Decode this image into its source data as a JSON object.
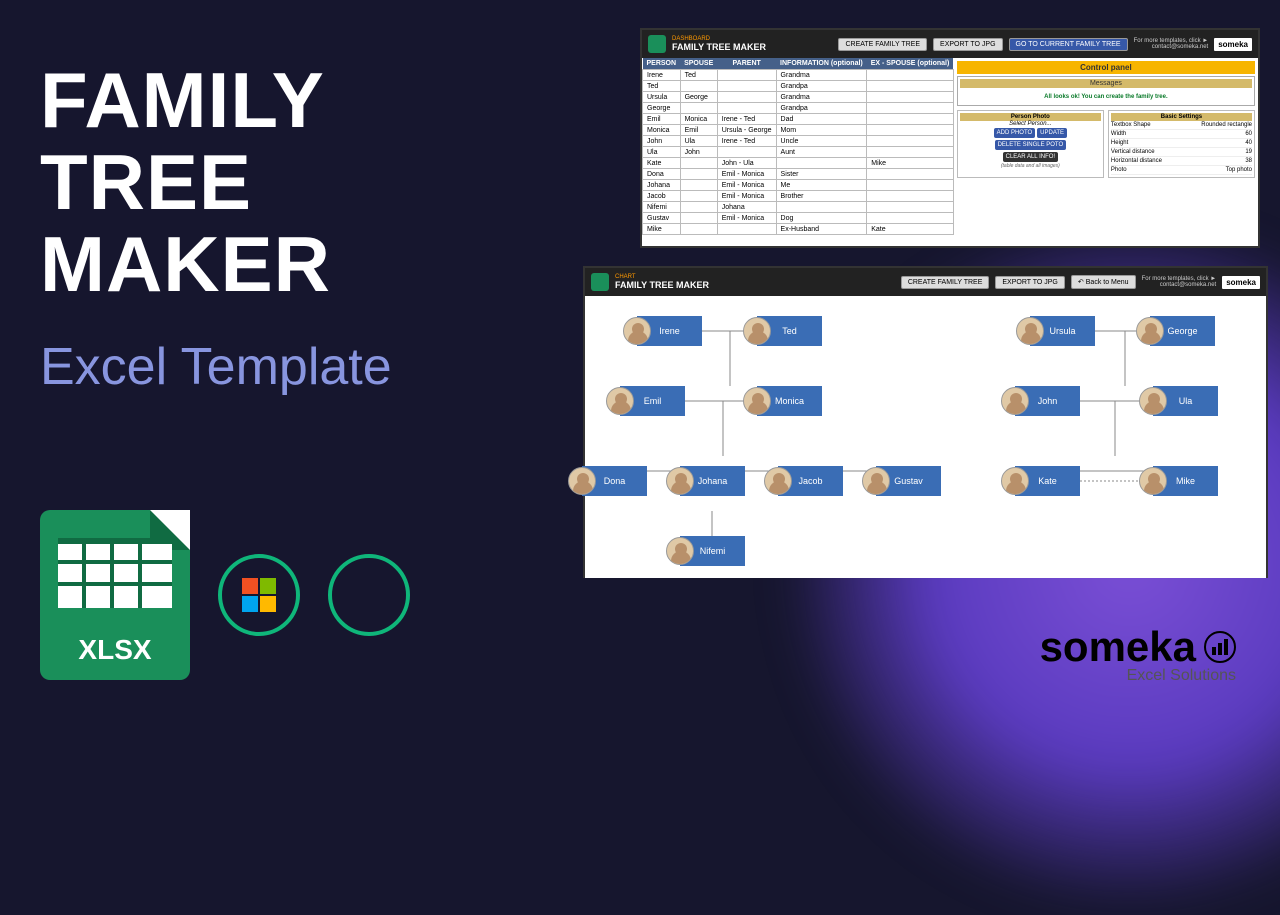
{
  "title_l1": "FAMILY",
  "title_l2": "TREE",
  "title_l3": "MAKER",
  "subtitle": "Excel Template",
  "xlsx_label": "XLSX",
  "brand": {
    "name": "someka",
    "sub": "Excel Solutions"
  },
  "dashboard": {
    "tab": "DASHBOARD",
    "name": "FAMILY TREE MAKER",
    "btn_create": "CREATE FAMILY TREE",
    "btn_export": "EXPORT TO JPG",
    "btn_goto": "GO TO  CURRENT FAMILY TREE",
    "more": "For more templates, click ►",
    "contact": "contact@someka.net",
    "cols": [
      "PERSON",
      "SPOUSE",
      "PARENT",
      "INFORMATION (optional)",
      "EX - SPOUSE (optional)"
    ],
    "rows": [
      [
        "Irene",
        "Ted",
        "",
        "Grandma",
        ""
      ],
      [
        "Ted",
        "",
        "",
        "Grandpa",
        ""
      ],
      [
        "Ursula",
        "George",
        "",
        "Grandma",
        ""
      ],
      [
        "George",
        "",
        "",
        "Grandpa",
        ""
      ],
      [
        "Emil",
        "Monica",
        "Irene - Ted",
        "Dad",
        ""
      ],
      [
        "Monica",
        "Emil",
        "Ursula - George",
        "Mom",
        ""
      ],
      [
        "John",
        "Ula",
        "Irene - Ted",
        "Uncle",
        ""
      ],
      [
        "Ula",
        "John",
        "",
        "Aunt",
        ""
      ],
      [
        "Kate",
        "",
        "John - Ula",
        "",
        "Mike"
      ],
      [
        "Dona",
        "",
        "Emil - Monica",
        "Sister",
        ""
      ],
      [
        "Johana",
        "",
        "Emil - Monica",
        "Me",
        ""
      ],
      [
        "Jacob",
        "",
        "Emil - Monica",
        "Brother",
        ""
      ],
      [
        "Nifemi",
        "",
        "Johana",
        "",
        ""
      ],
      [
        "Gustav",
        "",
        "Emil - Monica",
        "Dog",
        ""
      ],
      [
        "Mike",
        "",
        "",
        "Ex-Husband",
        "Kate"
      ]
    ],
    "control_panel": "Control panel",
    "messages_head": "Messages",
    "messages_text": "All looks ok! You can create the family tree.",
    "photo_head": "Person Photo",
    "photo_sel": "Select Person...",
    "btn_addphoto": "ADD PHOTO",
    "btn_update": "UPDATE",
    "btn_delphoto": "DELETE SINGLE POTO",
    "btn_clear": "CLEAR ALL INFO!",
    "btn_clear_sub": "(table data and all images)",
    "settings_head": "Basic Settings",
    "settings": [
      [
        "Textbox Shape",
        "Rounded rectangle"
      ],
      [
        "Width",
        "60"
      ],
      [
        "Height",
        "40"
      ],
      [
        "Vertical distance",
        "19"
      ],
      [
        "Horizontal distance",
        "38"
      ],
      [
        "Photo",
        "Top photo"
      ]
    ]
  },
  "chart": {
    "tab": "CHART",
    "name": "FAMILY TREE MAKER",
    "btn_create": "CREATE FAMILY TREE",
    "btn_export": "EXPORT TO JPG",
    "btn_back": "Back to Menu",
    "more": "For more templates, click ►",
    "contact": "contact@someka.net",
    "nodes": [
      "Irene",
      "Ted",
      "Ursula",
      "George",
      "Emil",
      "Monica",
      "John",
      "Ula",
      "Dona",
      "Johana",
      "Jacob",
      "Gustav",
      "Kate",
      "Mike",
      "Nifemi"
    ]
  }
}
